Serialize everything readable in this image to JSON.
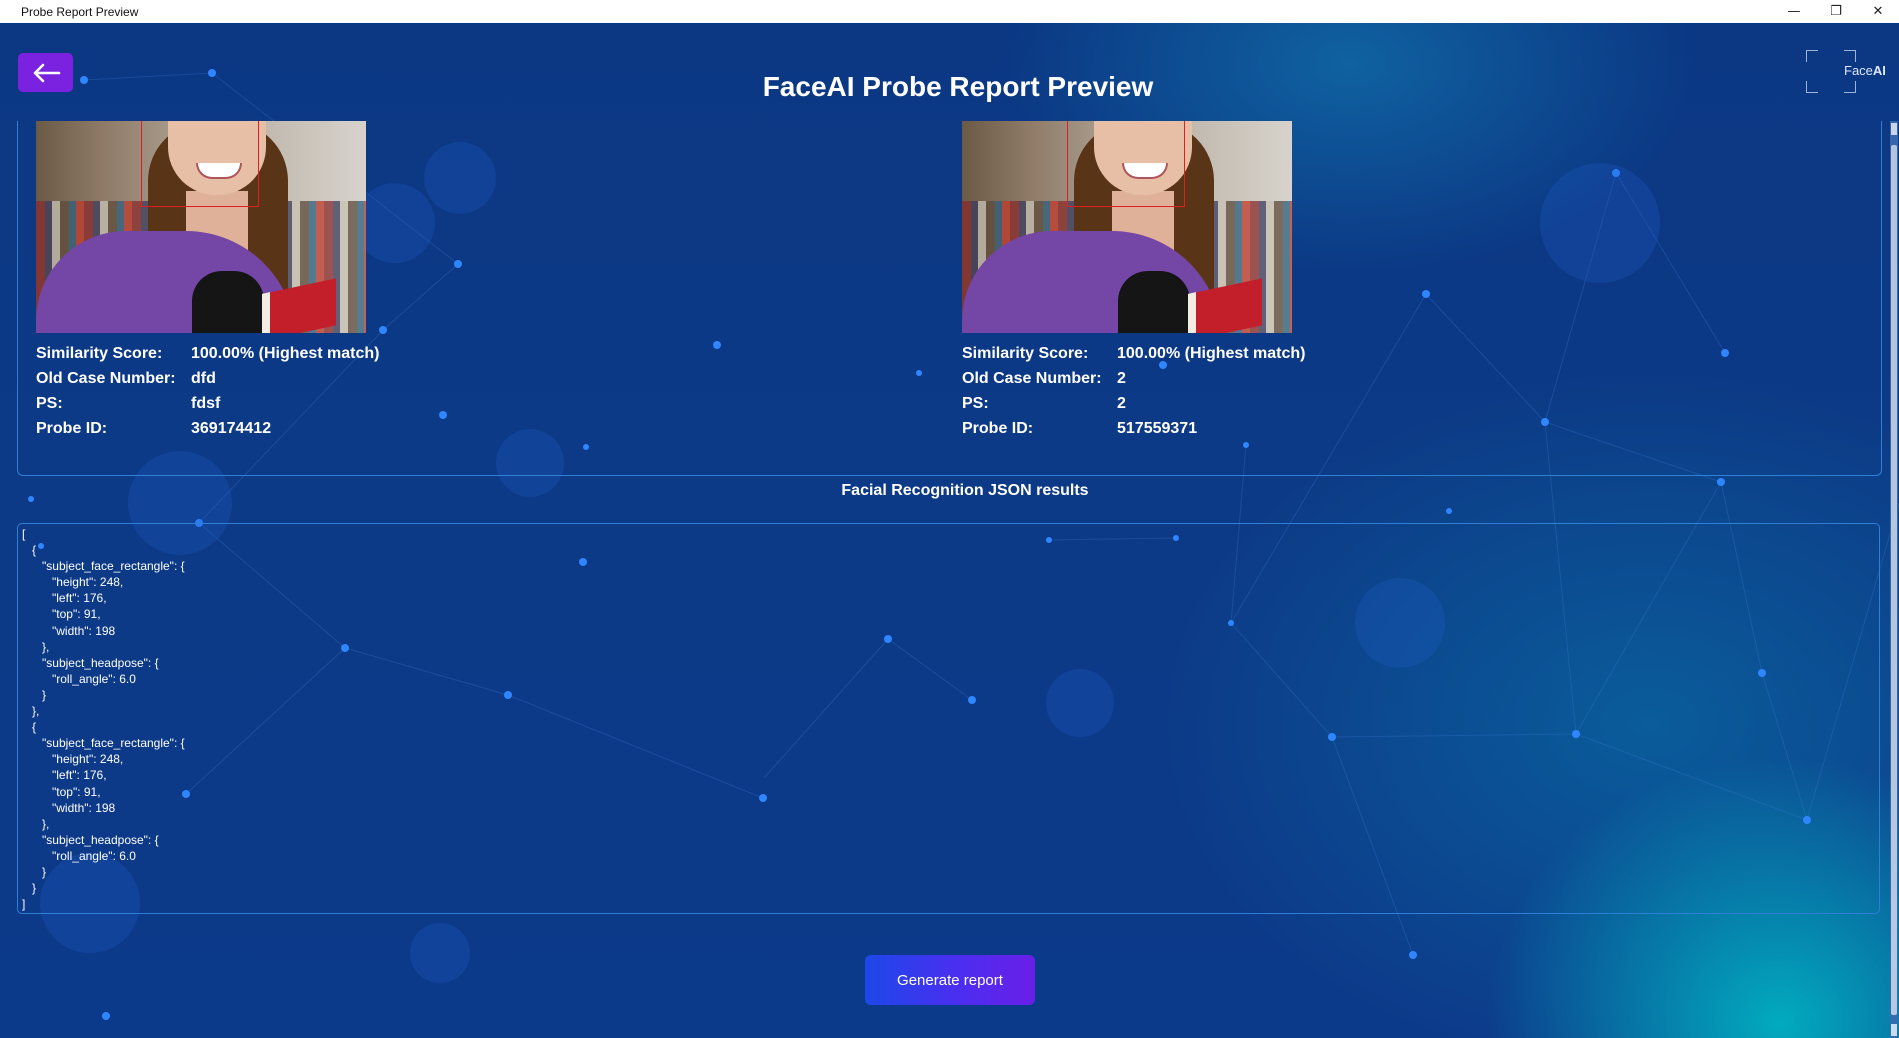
{
  "window": {
    "title": "Probe Report Preview",
    "controls": {
      "minimize": "—",
      "restore": "❐",
      "close": "✕"
    }
  },
  "header": {
    "title": "FaceAI Probe Report Preview",
    "logo": {
      "prefix": "Face",
      "suffix": "AI"
    }
  },
  "colors": {
    "accent": "#7a22e0",
    "border": "#2f7fd8",
    "face_box": "#e02020"
  },
  "results": [
    {
      "labels": {
        "similarity": "Similarity Score:",
        "case": "Old Case Number:",
        "ps": "PS:",
        "probe": "Probe ID:"
      },
      "similarity": "100.00% (Highest match)",
      "case": "dfd",
      "ps": "fdsf",
      "probe": "369174412"
    },
    {
      "labels": {
        "similarity": "Similarity Score:",
        "case": "Old Case Number:",
        "ps": "PS:",
        "probe": "Probe ID:"
      },
      "similarity": "100.00% (Highest match)",
      "case": "2",
      "ps": "2",
      "probe": "517559371"
    }
  ],
  "json_section": {
    "title": "Facial Recognition JSON results",
    "content": "[\n   {\n      \"subject_face_rectangle\": {\n         \"height\": 248,\n         \"left\": 176,\n         \"top\": 91,\n         \"width\": 198\n      },\n      \"subject_headpose\": {\n         \"roll_angle\": 6.0\n      }\n   },\n   {\n      \"subject_face_rectangle\": {\n         \"height\": 248,\n         \"left\": 176,\n         \"top\": 91,\n         \"width\": 198\n      },\n      \"subject_headpose\": {\n         \"roll_angle\": 6.0\n      }\n   }\n]"
  },
  "actions": {
    "generate": "Generate report"
  }
}
